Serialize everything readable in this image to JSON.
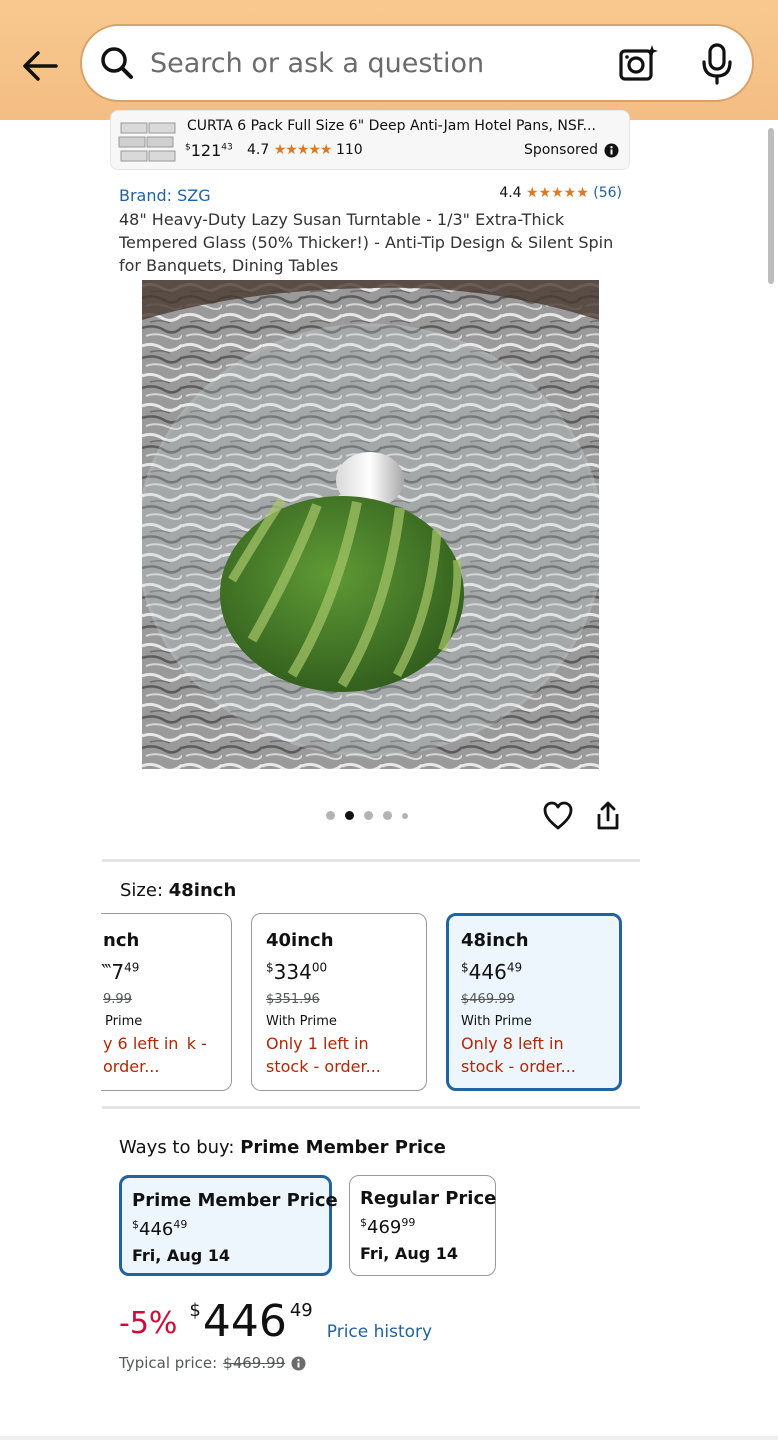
{
  "search": {
    "placeholder": "Search or ask a question"
  },
  "sponsored_ad": {
    "title": "CURTA 6 Pack Full Size 6\" Deep Anti-Jam Hotel Pans, NSF...",
    "price_currency": "$",
    "price_whole": "121",
    "price_fraction": "43",
    "rating": "4.7",
    "stars": "★★★★★",
    "review_count": "110",
    "label": "Sponsored"
  },
  "product": {
    "brand": "Brand: SZG",
    "rating": "4.4",
    "stars": "★★★★★",
    "review_count": "(56)",
    "title": "48\" Heavy-Duty Lazy Susan Turntable - 1/3\" Extra-Thick Tempered Glass (50% Thicker!) - Anti-Tip Design & Silent Spin for Banquets, Dining Tables",
    "image_count": 5,
    "image_index": 2
  },
  "size": {
    "label": "Size: ",
    "selected": "48inch",
    "options": [
      {
        "name": "nch",
        "currency": "",
        "price_whole": "‷7",
        "price_fraction": "49",
        "list_price": "9.99",
        "with_prime": "Prime",
        "stock": "y 6 left in  k - order..."
      },
      {
        "name": "40inch",
        "currency": "$",
        "price_whole": "334",
        "price_fraction": "00",
        "list_price": "$351.96",
        "with_prime": "With Prime",
        "stock": "Only 1 left in stock - order..."
      },
      {
        "name": "48inch",
        "currency": "$",
        "price_whole": "446",
        "price_fraction": "49",
        "list_price": "$469.99",
        "with_prime": "With Prime",
        "stock": "Only 8 left in stock - order..."
      }
    ]
  },
  "ways_to_buy": {
    "label": "Ways to buy: ",
    "selected": "Prime Member Price",
    "options": [
      {
        "label": "Prime Member Price",
        "currency": "$",
        "price_whole": "446",
        "price_fraction": "49",
        "date": "Fri, Aug 14"
      },
      {
        "label": "Regular Price",
        "currency": "$",
        "price_whole": "469",
        "price_fraction": "99",
        "date": "Fri, Aug 14"
      }
    ]
  },
  "pricing": {
    "discount": "-5%",
    "currency": "$",
    "whole": "446",
    "fraction": "49",
    "history_link": "Price history",
    "typical_label": "Typical price: ",
    "typical_price": "$469.99"
  },
  "colors": {
    "link": "#2162a1",
    "deal": "#cc0c39",
    "stock": "#b12704",
    "star": "#de7921",
    "header": "#f5c28a"
  }
}
